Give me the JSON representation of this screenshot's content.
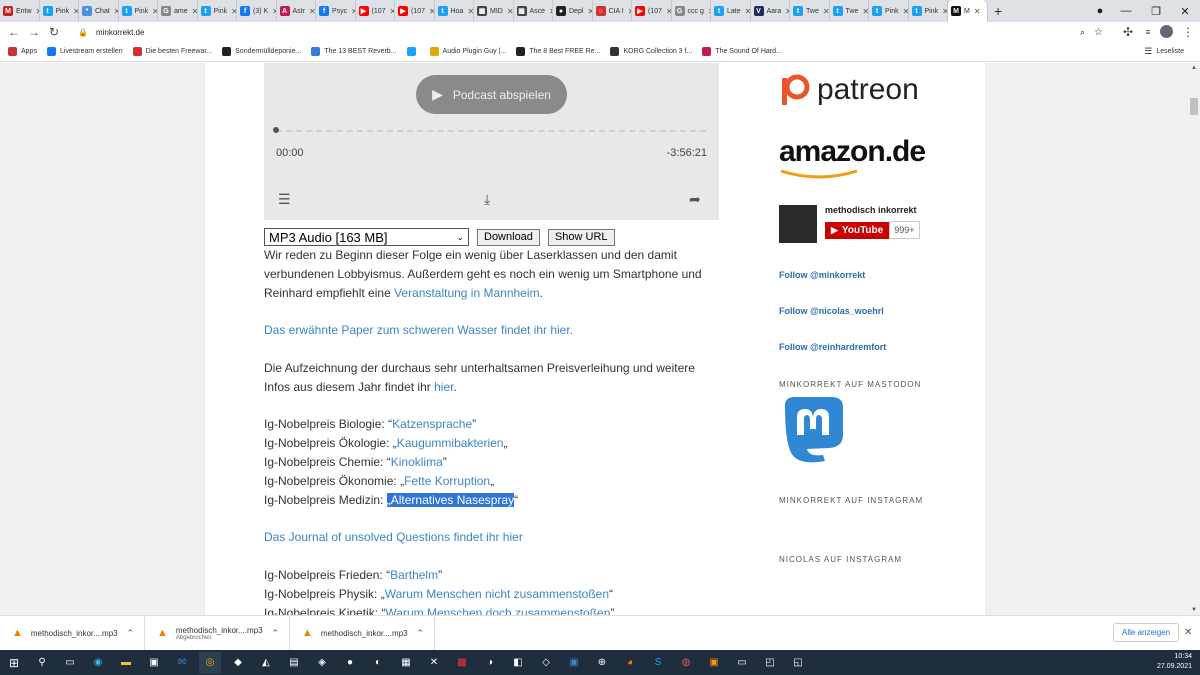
{
  "browser": {
    "tabs": [
      {
        "label": "Entw",
        "color": "#c5221f",
        "glyph": "M"
      },
      {
        "label": "Pink",
        "color": "#1da1f2",
        "glyph": "t"
      },
      {
        "label": "Chat",
        "color": "#4a90d9",
        "glyph": "*"
      },
      {
        "label": "Pink",
        "color": "#1da1f2",
        "glyph": "t"
      },
      {
        "label": "ame",
        "color": "#888888",
        "glyph": "G"
      },
      {
        "label": "Pink",
        "color": "#1da1f2",
        "glyph": "t"
      },
      {
        "label": "(3) K",
        "color": "#1877f2",
        "glyph": "f"
      },
      {
        "label": "Astr",
        "color": "#c2185b",
        "glyph": "A"
      },
      {
        "label": "Psyc",
        "color": "#1877f2",
        "glyph": "f"
      },
      {
        "label": "(107",
        "color": "#ff0000",
        "glyph": "▶"
      },
      {
        "label": "(107",
        "color": "#ff0000",
        "glyph": "▶"
      },
      {
        "label": "Hoa",
        "color": "#1da1f2",
        "glyph": "t"
      },
      {
        "label": "MID",
        "color": "#444444",
        "glyph": "▦"
      },
      {
        "label": "Asce",
        "color": "#444444",
        "glyph": "▦"
      },
      {
        "label": "Depl",
        "color": "#222222",
        "glyph": "●"
      },
      {
        "label": "CIA I",
        "color": "#d32f2f",
        "glyph": "○"
      },
      {
        "label": "(107",
        "color": "#ff0000",
        "glyph": "▶"
      },
      {
        "label": "ccc g",
        "color": "#888888",
        "glyph": "G"
      },
      {
        "label": "Late",
        "color": "#1da1f2",
        "glyph": "t"
      },
      {
        "label": "Aara",
        "color": "#1a2b5c",
        "glyph": "V"
      },
      {
        "label": "Twe",
        "color": "#1da1f2",
        "glyph": "t"
      },
      {
        "label": "Twe",
        "color": "#1da1f2",
        "glyph": "t"
      },
      {
        "label": "Pink",
        "color": "#1da1f2",
        "glyph": "t"
      },
      {
        "label": "Pink",
        "color": "#1da1f2",
        "glyph": "t"
      },
      {
        "label": "M",
        "color": "#111111",
        "glyph": "M",
        "active": true
      }
    ],
    "new_tab": "+",
    "url": "minkorrekt.de",
    "bookmarks": [
      {
        "label": "Apps",
        "color": "#c33"
      },
      {
        "label": "Livestream erstellen",
        "color": "#1877f2"
      },
      {
        "label": "Die besten Freewar...",
        "color": "#d32f2f"
      },
      {
        "label": "Sondermülldeponie...",
        "color": "#222"
      },
      {
        "label": "The 13 BEST Reverb...",
        "color": "#3a7bd5"
      },
      {
        "label": "",
        "color": "#1da1f2"
      },
      {
        "label": "Audio Plugin Guy |...",
        "color": "#e0a800"
      },
      {
        "label": "The 8 Best FREE Re...",
        "color": "#222"
      },
      {
        "label": "KORG Collection 3 f...",
        "color": "#333"
      },
      {
        "label": "The Sound Of Hard...",
        "color": "#c2185b"
      }
    ],
    "reading_list": "Leseliste"
  },
  "player": {
    "play_label": "Podcast abspielen",
    "time_current": "00:00",
    "time_remaining": "-3:56:21"
  },
  "download": {
    "format_selected": "MP3 Audio [163 MB]",
    "download_label": "Download",
    "showurl_label": "Show URL"
  },
  "article": {
    "p1_a": "Wir reden zu Beginn dieser Folge ein wenig über Laserklassen und den damit verbundenen Lobbyismus. Außerdem geht es noch ein wenig um Smartphone und Reinhard empfiehlt eine ",
    "p1_link": "Veranstaltung in Mannheim",
    "p1_b": ".",
    "p2_link": "Das erwähnte Paper zum schweren Wasser findet ihr hier.",
    "p3_a": "Die Aufzeichnung der durchaus sehr unterhaltsamen Preisverleihung und weitere Infos aus diesem Jahr findet ihr ",
    "p3_link": "hier",
    "p3_b": ".",
    "prizes1": [
      {
        "label": "Ig-Nobelpreis Biologie: ",
        "open": "“",
        "link": "Katzensprache",
        "close": "”"
      },
      {
        "label": "Ig-Nobelpreis Ökologie: ",
        "open": "„",
        "link": "Kaugummibakterien",
        "close": "„"
      },
      {
        "label": "Ig-Nobelpreis Chemie: ",
        "open": "“",
        "link": "Kinoklima",
        "close": "”"
      },
      {
        "label": "Ig-Nobelpreis Ökonomie: ",
        "open": "„",
        "link": "Fette Korruption",
        "close": "„"
      },
      {
        "label": "Ig-Nobelpreis Medizin: ",
        "open": "„",
        "link": "Alternatives Nasespray",
        "close": "“",
        "highlighted": true
      }
    ],
    "journal_link": "Das Journal of unsolved Questions findet ihr hier",
    "prizes2": [
      {
        "label": "Ig-Nobelpreis Frieden: ",
        "open": "“",
        "link": "Barthelm",
        "close": "”"
      },
      {
        "label": "Ig-Nobelpreis Physik: ",
        "open": "„",
        "link": "Warum Menschen nicht zusammenstoßen",
        "close": "“"
      },
      {
        "label": "Ig-Nobelpreis Kinetik: ",
        "open": "“",
        "link": "Warum Menschen doch zusammenstoßen",
        "close": "”"
      }
    ]
  },
  "sidebar": {
    "patreon": "patreon",
    "amazon": "amazon.de",
    "yt_channel": "methodisch inkorrekt",
    "yt_button": "YouTube",
    "yt_count": "999+",
    "follows": [
      "Follow @minkorrekt",
      "Follow @nicolas_woehrl",
      "Follow @reinhardremfort"
    ],
    "mastodon_heading": "MINKORREKT AUF MASTODON",
    "instagram_heading": "MINKORREKT AUF INSTAGRAM",
    "nicolas_heading": "NICOLAS AUF INSTAGRAM"
  },
  "downloads": [
    {
      "name": "methodisch_inkor....mp3",
      "status": ""
    },
    {
      "name": "methodisch_inkor....mp3",
      "status": "Abgebrochen"
    },
    {
      "name": "methodisch_inkor....mp3",
      "status": ""
    }
  ],
  "downloads_show_all": "Alle anzeigen",
  "clock": {
    "time": "10:34",
    "date": "27.09.2021"
  }
}
